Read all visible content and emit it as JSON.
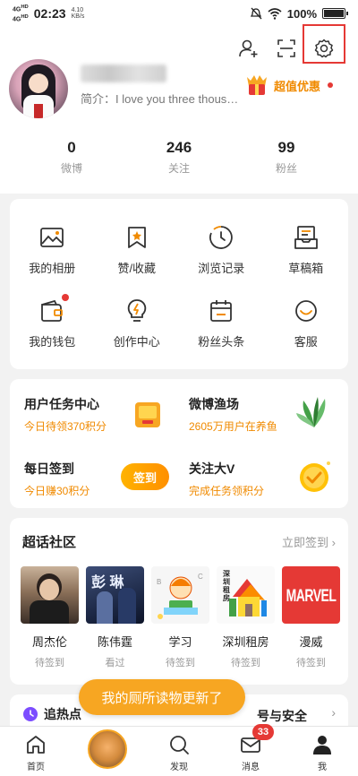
{
  "statusbar": {
    "network": "4G HD",
    "time": "02:23",
    "speed": "4.10 KB/s",
    "battery": "100%"
  },
  "header": {
    "add_friend_icon": "add-person-icon",
    "scan_icon": "scan-icon",
    "settings_icon": "gear-icon"
  },
  "profile": {
    "bio": "简介：I love you three thous…",
    "promo_label": "超值优惠"
  },
  "stats": [
    {
      "num": "0",
      "label": "微博"
    },
    {
      "num": "246",
      "label": "关注"
    },
    {
      "num": "99",
      "label": "粉丝"
    }
  ],
  "grid": [
    {
      "label": "我的相册",
      "icon": "photo-icon"
    },
    {
      "label": "赞/收藏",
      "icon": "bookmark-star-icon"
    },
    {
      "label": "浏览记录",
      "icon": "history-clock-icon"
    },
    {
      "label": "草稿箱",
      "icon": "drafts-icon"
    },
    {
      "label": "我的钱包",
      "icon": "wallet-icon"
    },
    {
      "label": "创作中心",
      "icon": "lightbulb-icon"
    },
    {
      "label": "粉丝头条",
      "icon": "calendar-icon"
    },
    {
      "label": "客服",
      "icon": "support-icon"
    }
  ],
  "tasks": {
    "user_task_title": "用户任务中心",
    "user_task_sub": "今日待领370积分",
    "fishery_title": "微博渔场",
    "fishery_sub": "2605万用户在养鱼",
    "checkin_title": "每日签到",
    "checkin_sub": "今日赚30积分",
    "checkin_button": "签到",
    "follow_title": "关注大V",
    "follow_sub": "完成任务领积分"
  },
  "community": {
    "title": "超话社区",
    "more": "立即签到",
    "topics": [
      {
        "name": "周杰伦",
        "status": "待签到"
      },
      {
        "name": "陈伟霆",
        "status": "看过"
      },
      {
        "name": "学习",
        "status": "待签到"
      },
      {
        "name": "深圳租房",
        "status": "待签到"
      },
      {
        "name": "漫威",
        "status": "待签到"
      }
    ],
    "marvel_logo": "MARVEL",
    "zuling_text": "深圳租房"
  },
  "peek": {
    "left": "追热点",
    "right": "号与安全"
  },
  "toast": "我的厕所读物更新了",
  "tabbar": [
    {
      "label": "首页"
    },
    {
      "label": ""
    },
    {
      "label": "发现"
    },
    {
      "label": "消息",
      "badge": "33"
    },
    {
      "label": "我"
    }
  ],
  "colors": {
    "accent": "#f08a00",
    "badge": "#e53935",
    "toast": "#f7a622"
  }
}
